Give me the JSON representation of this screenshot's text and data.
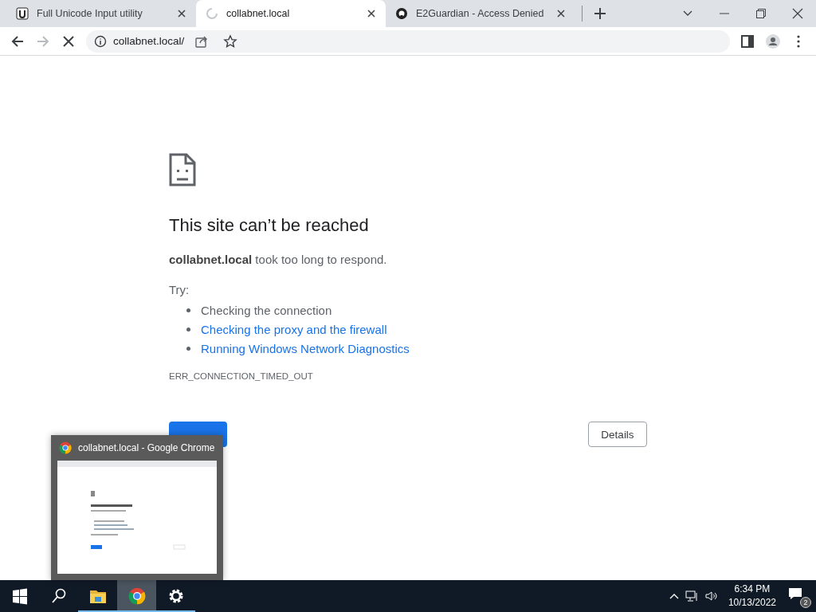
{
  "tabs": [
    {
      "title": "Full Unicode Input utility",
      "kind": "unicode",
      "selected": false
    },
    {
      "title": "collabnet.local",
      "kind": "loading",
      "selected": true
    },
    {
      "title": "E2Guardian - Access Denied",
      "kind": "github",
      "selected": false
    }
  ],
  "toolbar": {
    "address": "collabnet.local/"
  },
  "error_page": {
    "title": "This site can’t be reached",
    "message": "**collabnet.local** took too long to respond.",
    "try_label": "Try:",
    "suggestions": [
      {
        "text": "Checking the connection",
        "kind": "text"
      },
      {
        "text": "Checking the proxy and the firewall",
        "kind": "link"
      },
      {
        "text": "Running Windows Network Diagnostics",
        "kind": "link"
      }
    ],
    "error_code": "ERR_CONNECTION_TIMED_OUT",
    "details_button": "Details"
  },
  "taskbar_preview": {
    "title": "collabnet.local - Google Chrome"
  },
  "taskbar": {
    "apps": [
      {
        "kind": "start",
        "selected": false,
        "running": false
      },
      {
        "kind": "search",
        "selected": false,
        "running": false
      },
      {
        "kind": "files",
        "selected": false,
        "running": true
      },
      {
        "kind": "chrome",
        "selected": true,
        "running": true
      },
      {
        "kind": "settings",
        "selected": false,
        "running": true
      }
    ],
    "time": "6:34 PM",
    "date": "10/13/2022",
    "notification_count": "2"
  }
}
